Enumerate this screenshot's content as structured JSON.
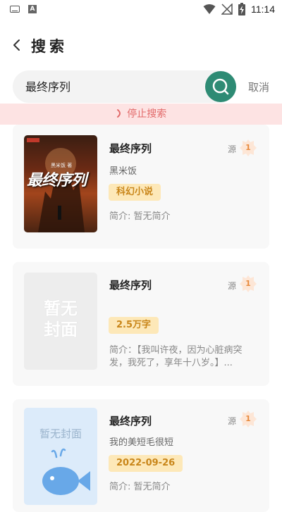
{
  "status_bar": {
    "time": "11:14",
    "a_icon_label": "A"
  },
  "header": {
    "title": "搜索"
  },
  "search": {
    "value": "最终序列",
    "cancel_label": "取消"
  },
  "stop_bar": {
    "label": "停止搜索"
  },
  "results": [
    {
      "title": "最终序列",
      "source_label": "源",
      "source_count": "1",
      "author": "黑米饭",
      "tag": "科幻小说",
      "intro": "简介: 暂无简介",
      "cover_text": "最终序列",
      "cover_publisher": "黑米饭 著"
    },
    {
      "title": "最终序列",
      "source_label": "源",
      "source_count": "1",
      "author": "",
      "tag": "2.5万字",
      "intro": "简介：【我叫许夜，因为心脏病突发，我死了，享年十八岁。】...",
      "cover_text": "暂无\n封面"
    },
    {
      "title": "最终序列",
      "source_label": "源",
      "source_count": "1",
      "author": "我的美短毛很短",
      "tag": "2022-09-26",
      "intro": "简介: 暂无简介",
      "cover_text": "暂无封面"
    }
  ]
}
